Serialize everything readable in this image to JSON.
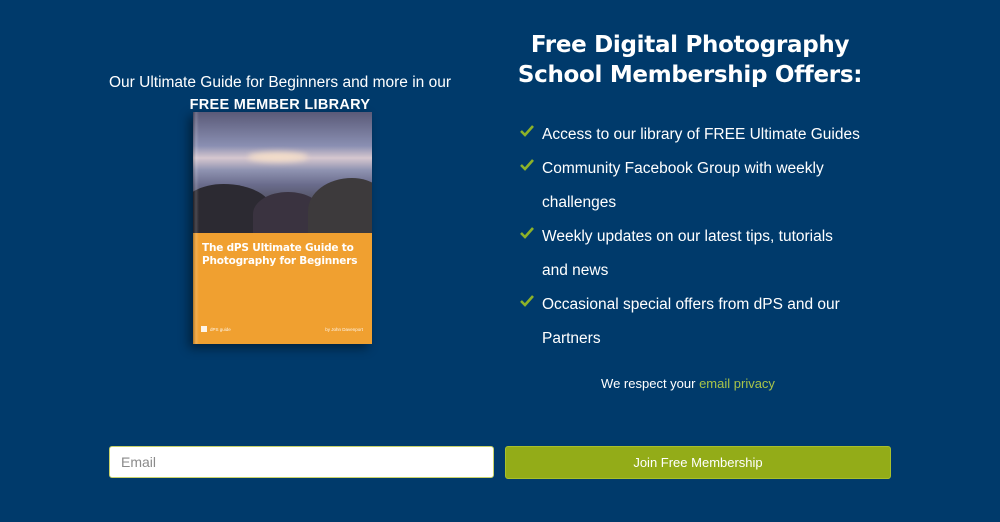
{
  "left": {
    "intro_line": "Our Ultimate Guide for Beginners and more in our",
    "intro_strong": "FREE MEMBER LIBRARY"
  },
  "book": {
    "title": "The dPS Ultimate Guide to Photography for Beginners",
    "logo_text": "dPS guide",
    "author": "by John Davenport"
  },
  "right": {
    "headline_line1": "Free Digital Photography",
    "headline_line2": "School Membership Offers:",
    "benefits": [
      "Access to our library of FREE Ultimate Guides",
      "Community Facebook Group with weekly challenges",
      "Weekly updates on our latest tips, tutorials and news",
      "Occasional special offers from dPS and our Partners"
    ],
    "check_icon": "check-icon",
    "check_color": "#8db228"
  },
  "privacy": {
    "prefix": "We respect your ",
    "link": "email privacy"
  },
  "form": {
    "email_placeholder": "Email",
    "email_value": "",
    "button_label": "Join Free Membership"
  },
  "colors": {
    "background": "#003a6b",
    "accent": "#93ac18",
    "link": "#a7c44a",
    "book_cover": "#f0a030"
  }
}
